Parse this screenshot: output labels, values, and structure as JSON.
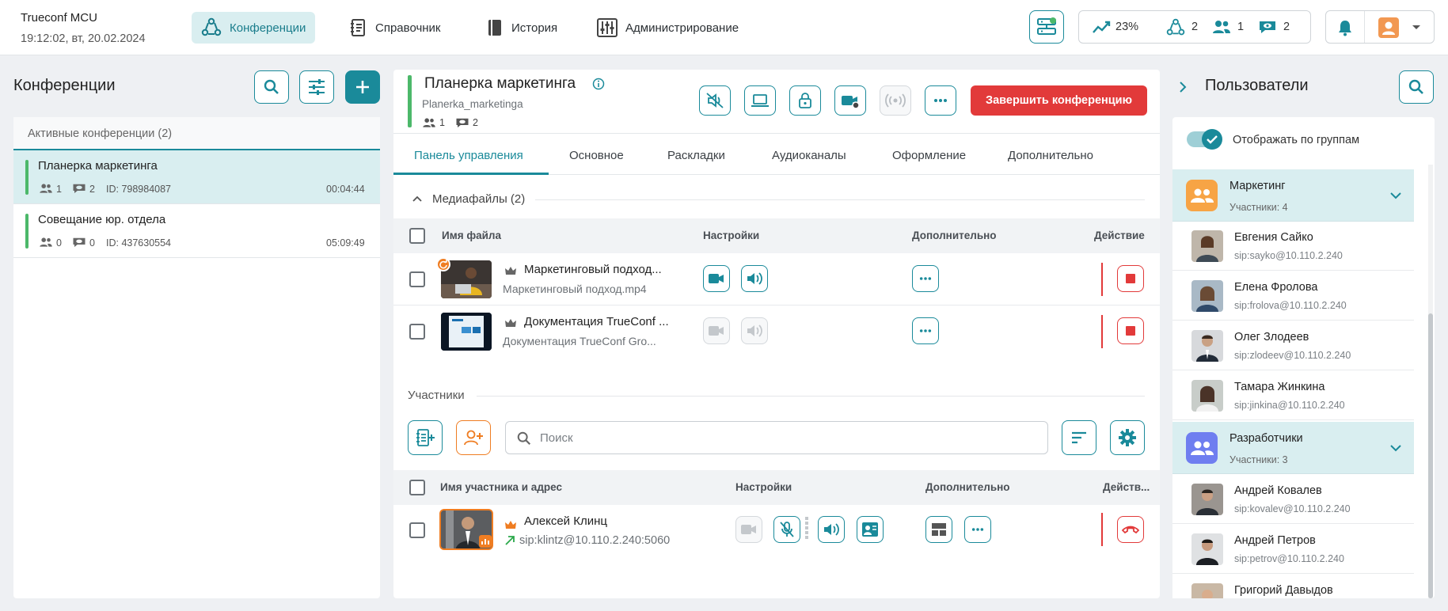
{
  "app": {
    "name": "Trueconf MCU",
    "datetime": "19:12:02, вт, 20.02.2024"
  },
  "nav": {
    "conferences": "Конференции",
    "directory": "Справочник",
    "history": "История",
    "admin": "Администрирование"
  },
  "stats": {
    "load": "23%",
    "conferences": "2",
    "participants": "1",
    "viewers": "2"
  },
  "left": {
    "title": "Конференции",
    "active_header": "Активные конференции (2)",
    "conferences": [
      {
        "name": "Планерка маркетинга",
        "participants": "1",
        "viewers": "2",
        "id": "ID: 798984087",
        "time": "00:04:44"
      },
      {
        "name": "Совещание юр. отдела",
        "participants": "0",
        "viewers": "0",
        "id": "ID: 437630554",
        "time": "05:09:49"
      }
    ]
  },
  "conf": {
    "title": "Планерка маркетинга",
    "slug": "Planerka_marketinga",
    "participants": "1",
    "viewers": "2",
    "end_button": "Завершить конференцию",
    "tabs": [
      "Панель управления",
      "Основное",
      "Раскладки",
      "Аудиоканалы",
      "Оформление",
      "Дополнительно"
    ],
    "media": {
      "header": "Медиафайлы (2)",
      "columns": [
        "Имя файла",
        "Настройки",
        "Дополнительно",
        "Действие"
      ],
      "rows": [
        {
          "title": "Маркетинговый подход...",
          "file": "Маркетинговый подход.mp4"
        },
        {
          "title": "Документация TrueConf ...",
          "file": "Документация TrueConf Gro..."
        }
      ]
    },
    "participants_section": {
      "header": "Участники",
      "search_placeholder": "Поиск",
      "columns": [
        "Имя участника и адрес",
        "Настройки",
        "Дополнительно",
        "Действ..."
      ],
      "rows": [
        {
          "name": "Алексей Клинц",
          "address": "sip:klintz@10.110.2.240:5060"
        }
      ]
    }
  },
  "right": {
    "title": "Пользователи",
    "group_toggle": "Отображать по группам",
    "groups": [
      {
        "name": "Маркетинг",
        "count": "Участники: 4",
        "color": "#f7a445",
        "users": [
          {
            "name": "Евгения Сайко",
            "sip": "sip:sayko@10.110.2.240"
          },
          {
            "name": "Елена Фролова",
            "sip": "sip:frolova@10.110.2.240"
          },
          {
            "name": "Олег Злодеев",
            "sip": "sip:zlodeev@10.110.2.240"
          },
          {
            "name": "Тамара Жинкина",
            "sip": "sip:jinkina@10.110.2.240"
          }
        ]
      },
      {
        "name": "Разработчики",
        "count": "Участники: 3",
        "color": "#6f7ef0",
        "users": [
          {
            "name": "Андрей Ковалев",
            "sip": "sip:kovalev@10.110.2.240"
          },
          {
            "name": "Андрей Петров",
            "sip": "sip:petrov@10.110.2.240"
          },
          {
            "name": "Григорий Давыдов",
            "sip": ""
          }
        ]
      }
    ]
  },
  "colors": {
    "accent": "#1a8a9a",
    "danger": "#e23a3a",
    "orange": "#ef7d22",
    "active_bg": "#d9eef0",
    "green": "#4cb86a"
  }
}
